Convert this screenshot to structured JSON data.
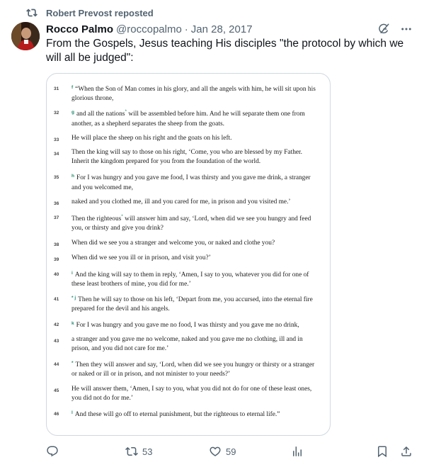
{
  "repost": {
    "label": "Robert Prevost reposted",
    "icon": "repost-icon"
  },
  "author": {
    "name": "Rocco Palmo",
    "handle": "@roccopalmo",
    "separator": "·",
    "date": "Jan 28, 2017"
  },
  "post": {
    "text": "From the Gospels, Jesus teaching His disciples \"the protocol by which we will all be judged\":"
  },
  "media": {
    "verses": [
      {
        "num": "31",
        "fn": "f",
        "text": "“When the Son of Man comes in his glory, and all the angels with him, he will sit upon his glorious throne,"
      },
      {
        "num": "32",
        "fn": "g",
        "text_a": "and all the nations",
        "ast": "*",
        "text_b": " will be assembled before him. And he will separate them one from another, as a shepherd separates the sheep from the goats."
      },
      {
        "num": "33",
        "text": "He will place the sheep on his right and the goats on his left."
      },
      {
        "num": "34",
        "text": "Then the king will say to those on his right, ‘Come, you who are blessed by my Father. Inherit the kingdom prepared for you from the foundation of the world."
      },
      {
        "num": "35",
        "fn": "h",
        "text": "For I was hungry and you gave me food, I was thirsty and you gave me drink, a stranger and you welcomed me,"
      },
      {
        "num": "36",
        "text": "naked and you clothed me, ill and you cared for me, in prison and you visited me.’"
      },
      {
        "num": "37",
        "text_a": "Then the righteous",
        "ast": "*",
        "text_b": " will answer him and say, ‘Lord, when did we see you hungry and feed you, or thirsty and give you drink?"
      },
      {
        "num": "38",
        "text": "When did we see you a stranger and welcome you, or naked and clothe you?"
      },
      {
        "num": "39",
        "text": "When did we see you ill or in prison, and visit you?’"
      },
      {
        "num": "40",
        "fn": "i",
        "text": "And the king will say to them in reply, ‘Amen, I say to you, whatever you did for one of these least brothers of mine, you did for me.’"
      },
      {
        "num": "41",
        "fn": "* j",
        "text": "Then he will say to those on his left, ‘Depart from me, you accursed, into the eternal fire prepared for the devil and his angels."
      },
      {
        "num": "42",
        "fn": "k",
        "text": "For I was hungry and you gave me no food, I was thirsty and you gave me no drink,"
      },
      {
        "num": "43",
        "text": "a stranger and you gave me no welcome, naked and you gave me no clothing, ill and in prison, and you did not care for me.’"
      },
      {
        "num": "44",
        "fn": "*",
        "text": "Then they will answer and say, ‘Lord, when did we see you hungry or thirsty or a stranger or naked or ill or in prison, and not minister to your needs?’"
      },
      {
        "num": "45",
        "text": "He will answer them, ‘Amen, I say to you, what you did not do for one of these least ones, you did not do for me.’"
      },
      {
        "num": "46",
        "fn": "l",
        "text": "And these will go off to eternal punishment, but the righteous to eternal life.”"
      }
    ]
  },
  "actions": {
    "reply_count": "",
    "repost_count": "53",
    "like_count": "59",
    "views_count": ""
  },
  "icons": [
    "repost-icon",
    "grok-icon",
    "more-icon",
    "reply-icon",
    "like-icon",
    "views-icon",
    "bookmark-icon",
    "share-icon"
  ],
  "colors": {
    "text": "#0f1419",
    "muted": "#536471",
    "border": "#cfd9de",
    "footnote": "#1f8a6e"
  }
}
